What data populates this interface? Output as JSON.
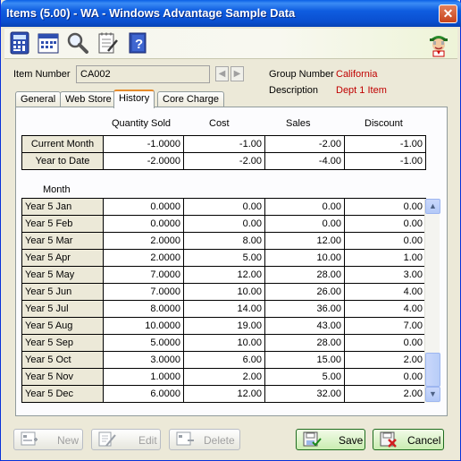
{
  "window": {
    "title": "Items (5.00) - WA - Windows Advantage Sample Data",
    "close_label": "✕"
  },
  "toolbar": {
    "icons": [
      "calculator-icon",
      "calendar-icon",
      "magnifier-icon",
      "notepad-icon",
      "help-book-icon"
    ],
    "mascot": "mascot-icon"
  },
  "header": {
    "item_number_label": "Item Number",
    "item_number_value": "CA002",
    "group_number_label": "Group Number",
    "group_number_value": "California",
    "description_label": "Description",
    "description_value": "Dept 1 Item"
  },
  "tabs": [
    {
      "label": "General"
    },
    {
      "label": "Web Store"
    },
    {
      "label": "History"
    },
    {
      "label": "Core Charge"
    }
  ],
  "columns": [
    "Quantity Sold",
    "Cost",
    "Sales",
    "Discount"
  ],
  "summary": [
    {
      "label": "Current Month",
      "qty": "-1.0000",
      "cost": "-1.00",
      "sales": "-2.00",
      "discount": "-1.00"
    },
    {
      "label": "Year to Date",
      "qty": "-2.0000",
      "cost": "-2.00",
      "sales": "-4.00",
      "discount": "-1.00"
    }
  ],
  "month_label": "Month",
  "months": [
    {
      "label": "Year 5 Jan",
      "qty": "0.0000",
      "cost": "0.00",
      "sales": "0.00",
      "discount": "0.00"
    },
    {
      "label": "Year 5 Feb",
      "qty": "0.0000",
      "cost": "0.00",
      "sales": "0.00",
      "discount": "0.00"
    },
    {
      "label": "Year 5 Mar",
      "qty": "2.0000",
      "cost": "8.00",
      "sales": "12.00",
      "discount": "0.00"
    },
    {
      "label": "Year 5 Apr",
      "qty": "2.0000",
      "cost": "5.00",
      "sales": "10.00",
      "discount": "1.00"
    },
    {
      "label": "Year 5 May",
      "qty": "7.0000",
      "cost": "12.00",
      "sales": "28.00",
      "discount": "3.00"
    },
    {
      "label": "Year 5 Jun",
      "qty": "7.0000",
      "cost": "10.00",
      "sales": "26.00",
      "discount": "4.00"
    },
    {
      "label": "Year 5 Jul",
      "qty": "8.0000",
      "cost": "14.00",
      "sales": "36.00",
      "discount": "4.00"
    },
    {
      "label": "Year 5 Aug",
      "qty": "10.0000",
      "cost": "19.00",
      "sales": "43.00",
      "discount": "7.00"
    },
    {
      "label": "Year 5 Sep",
      "qty": "5.0000",
      "cost": "10.00",
      "sales": "28.00",
      "discount": "0.00"
    },
    {
      "label": "Year 5 Oct",
      "qty": "3.0000",
      "cost": "6.00",
      "sales": "15.00",
      "discount": "2.00"
    },
    {
      "label": "Year 5 Nov",
      "qty": "1.0000",
      "cost": "2.00",
      "sales": "5.00",
      "discount": "0.00"
    },
    {
      "label": "Year 5 Dec",
      "qty": "6.0000",
      "cost": "12.00",
      "sales": "32.00",
      "discount": "2.00"
    }
  ],
  "buttons": {
    "new": "New",
    "edit": "Edit",
    "delete": "Delete",
    "save": "Save",
    "cancel": "Cancel"
  }
}
